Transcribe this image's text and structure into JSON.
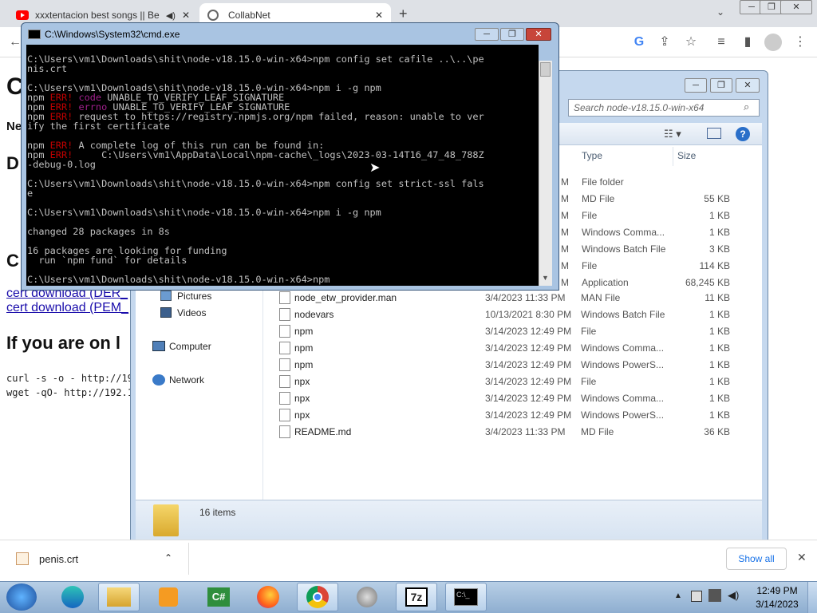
{
  "chrome": {
    "tabs": [
      {
        "title": "xxxtentacion best songs || Be",
        "active": false
      },
      {
        "title": "CollabNet",
        "active": true
      }
    ],
    "window_buttons": [
      "─",
      "❐",
      "✕"
    ]
  },
  "webpage": {
    "headings": [
      "C",
      "Ne",
      "D",
      "C"
    ],
    "links": [
      "cert download (DER_",
      "cert download (PEM_"
    ],
    "section_heading": "If you are on l",
    "commands": [
      "curl -s -o - http://19",
      "wget -qO- http://192.1"
    ]
  },
  "cmd": {
    "title": "C:\\Windows\\System32\\cmd.exe",
    "lines": [
      [
        {
          "t": "C:\\Users\\vm1\\Downloads\\shit\\node-v18.15.0-win-x64>npm config set cafile ..\\..\\pe"
        }
      ],
      [
        {
          "t": "nis.crt"
        }
      ],
      [
        {
          "t": ""
        }
      ],
      [
        {
          "t": "C:\\Users\\vm1\\Downloads\\shit\\node-v18.15.0-win-x64>npm i -g npm"
        }
      ],
      [
        {
          "t": "npm "
        },
        {
          "t": "ERR!",
          "c": "err"
        },
        {
          "t": " "
        },
        {
          "t": "code",
          "c": "kw"
        },
        {
          "t": " UNABLE_TO_VERIFY_LEAF_SIGNATURE"
        }
      ],
      [
        {
          "t": "npm "
        },
        {
          "t": "ERR!",
          "c": "err"
        },
        {
          "t": " "
        },
        {
          "t": "errno",
          "c": "kw"
        },
        {
          "t": " UNABLE_TO_VERIFY_LEAF_SIGNATURE"
        }
      ],
      [
        {
          "t": "npm "
        },
        {
          "t": "ERR!",
          "c": "err"
        },
        {
          "t": " request to https://registry.npmjs.org/npm failed, reason: unable to ver"
        }
      ],
      [
        {
          "t": "ify the first certificate"
        }
      ],
      [
        {
          "t": ""
        }
      ],
      [
        {
          "t": "npm "
        },
        {
          "t": "ERR!",
          "c": "err"
        },
        {
          "t": " A complete log of this run can be found in:"
        }
      ],
      [
        {
          "t": "npm "
        },
        {
          "t": "ERR!",
          "c": "err"
        },
        {
          "t": "     C:\\Users\\vm1\\AppData\\Local\\npm-cache\\_logs\\2023-03-14T16_47_48_788Z"
        }
      ],
      [
        {
          "t": "-debug-0.log"
        }
      ],
      [
        {
          "t": ""
        }
      ],
      [
        {
          "t": "C:\\Users\\vm1\\Downloads\\shit\\node-v18.15.0-win-x64>npm config set strict-ssl fals"
        }
      ],
      [
        {
          "t": "e"
        }
      ],
      [
        {
          "t": ""
        }
      ],
      [
        {
          "t": "C:\\Users\\vm1\\Downloads\\shit\\node-v18.15.0-win-x64>npm i -g npm"
        }
      ],
      [
        {
          "t": ""
        }
      ],
      [
        {
          "t": "changed 28 packages in 8s"
        }
      ],
      [
        {
          "t": ""
        }
      ],
      [
        {
          "t": "16 packages are looking for funding"
        }
      ],
      [
        {
          "t": "  run `npm fund` for details"
        }
      ],
      [
        {
          "t": ""
        }
      ],
      [
        {
          "t": "C:\\Users\\vm1\\Downloads\\shit\\node-v18.15.0-win-x64>npm"
        }
      ]
    ]
  },
  "explorer": {
    "search_placeholder": "Search node-v18.15.0-win-x64",
    "columns": {
      "type": "Type",
      "size": "Size"
    },
    "partial_rows": [
      {
        "type": "File folder",
        "size": ""
      },
      {
        "type": "MD File",
        "size": "55 KB"
      },
      {
        "type": "File",
        "size": "1 KB"
      },
      {
        "type": "Windows Comma...",
        "size": "1 KB"
      },
      {
        "type": "Windows Batch File",
        "size": "3 KB"
      },
      {
        "type": "File",
        "size": "114 KB"
      },
      {
        "type": "Application",
        "size": "68,245 KB"
      }
    ],
    "rows": [
      {
        "name": "node_etw_provider.man",
        "date": "3/4/2023 11:33 PM",
        "type": "MAN File",
        "size": "11 KB"
      },
      {
        "name": "nodevars",
        "date": "10/13/2021 8:30 PM",
        "type": "Windows Batch File",
        "size": "1 KB"
      },
      {
        "name": "npm",
        "date": "3/14/2023 12:49 PM",
        "type": "File",
        "size": "1 KB"
      },
      {
        "name": "npm",
        "date": "3/14/2023 12:49 PM",
        "type": "Windows Comma...",
        "size": "1 KB"
      },
      {
        "name": "npm",
        "date": "3/14/2023 12:49 PM",
        "type": "Windows PowerS...",
        "size": "1 KB"
      },
      {
        "name": "npx",
        "date": "3/14/2023 12:49 PM",
        "type": "File",
        "size": "1 KB"
      },
      {
        "name": "npx",
        "date": "3/14/2023 12:49 PM",
        "type": "Windows Comma...",
        "size": "1 KB"
      },
      {
        "name": "npx",
        "date": "3/14/2023 12:49 PM",
        "type": "Windows PowerS...",
        "size": "1 KB"
      },
      {
        "name": "README.md",
        "date": "3/4/2023 11:33 PM",
        "type": "MD File",
        "size": "36 KB"
      }
    ],
    "nav": [
      {
        "label": "Pictures",
        "icon": "pictures-icon"
      },
      {
        "label": "Videos",
        "icon": "videos-icon"
      },
      {
        "label": "Computer",
        "icon": "computer-icon"
      },
      {
        "label": "Network",
        "icon": "network-icon"
      }
    ],
    "status": "16 items"
  },
  "downloads": {
    "file": "penis.crt",
    "show_all": "Show all"
  },
  "taskbar": {
    "time": "12:49 PM",
    "date": "3/14/2023",
    "apps": [
      "windows-start",
      "edge",
      "explorer",
      "media-player",
      "csharp",
      "firefox",
      "chrome",
      "speaker",
      "7zip",
      "cmd"
    ]
  }
}
